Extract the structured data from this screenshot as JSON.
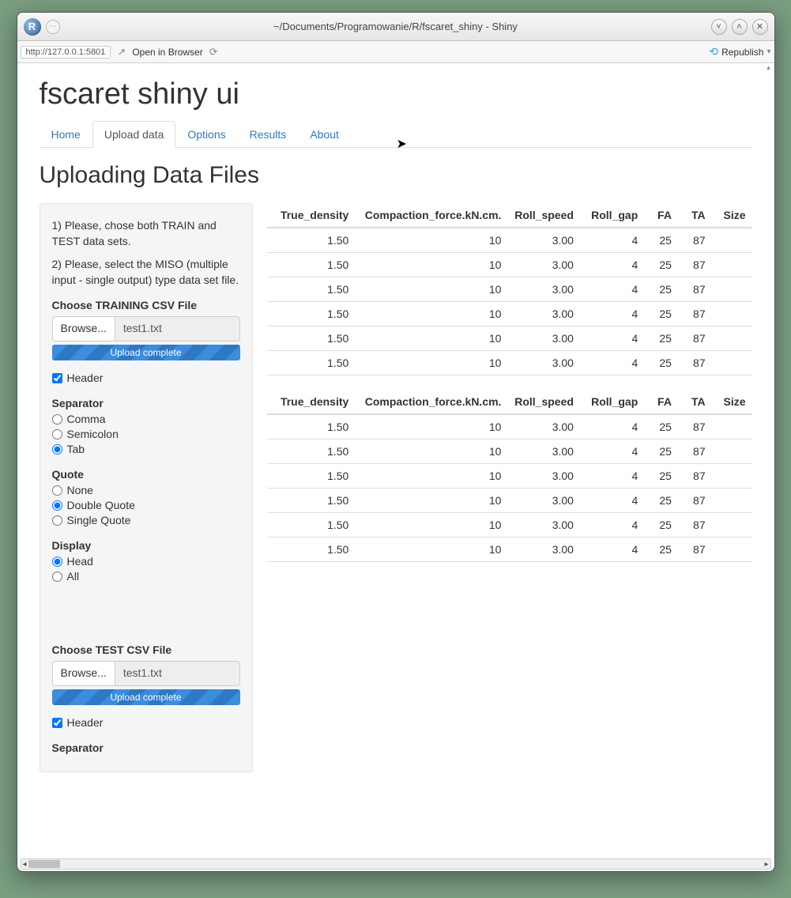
{
  "window": {
    "title": "~/Documents/Programowanie/R/fscaret_shiny - Shiny"
  },
  "toolbar": {
    "url": "http://127.0.0.1:5801",
    "open_in_browser": "Open in Browser",
    "republish": "Republish"
  },
  "app": {
    "title": "fscaret shiny ui"
  },
  "tabs": [
    "Home",
    "Upload data",
    "Options",
    "Results",
    "About"
  ],
  "active_tab_index": 1,
  "section_title": "Uploading Data Files",
  "sidebar": {
    "intro1": "1) Please, chose both TRAIN and TEST data sets.",
    "intro2": "2) Please, select the MISO (multiple input - single output) type data set file.",
    "train": {
      "label": "Choose TRAINING CSV File",
      "browse": "Browse...",
      "filename": "test1.txt",
      "progress": "Upload complete",
      "header_label": "Header",
      "header_checked": true,
      "separator_label": "Separator",
      "separator_options": [
        "Comma",
        "Semicolon",
        "Tab"
      ],
      "separator_selected": 2,
      "quote_label": "Quote",
      "quote_options": [
        "None",
        "Double Quote",
        "Single Quote"
      ],
      "quote_selected": 1,
      "display_label": "Display",
      "display_options": [
        "Head",
        "All"
      ],
      "display_selected": 0
    },
    "test": {
      "label": "Choose TEST CSV File",
      "browse": "Browse...",
      "filename": "test1.txt",
      "progress": "Upload complete",
      "header_label": "Header",
      "header_checked": true,
      "separator_label": "Separator"
    }
  },
  "table": {
    "headers": [
      "True_density",
      "Compaction_force.kN.cm.",
      "Roll_speed",
      "Roll_gap",
      "FA",
      "TA",
      "Size"
    ],
    "col_widths": [
      "110",
      "190",
      "90",
      "80",
      "42",
      "42",
      "50"
    ],
    "rows1": [
      [
        "1.50",
        "10",
        "3.00",
        "4",
        "25",
        "87",
        ""
      ],
      [
        "1.50",
        "10",
        "3.00",
        "4",
        "25",
        "87",
        ""
      ],
      [
        "1.50",
        "10",
        "3.00",
        "4",
        "25",
        "87",
        ""
      ],
      [
        "1.50",
        "10",
        "3.00",
        "4",
        "25",
        "87",
        ""
      ],
      [
        "1.50",
        "10",
        "3.00",
        "4",
        "25",
        "87",
        ""
      ],
      [
        "1.50",
        "10",
        "3.00",
        "4",
        "25",
        "87",
        ""
      ]
    ],
    "rows2": [
      [
        "1.50",
        "10",
        "3.00",
        "4",
        "25",
        "87",
        ""
      ],
      [
        "1.50",
        "10",
        "3.00",
        "4",
        "25",
        "87",
        ""
      ],
      [
        "1.50",
        "10",
        "3.00",
        "4",
        "25",
        "87",
        ""
      ],
      [
        "1.50",
        "10",
        "3.00",
        "4",
        "25",
        "87",
        ""
      ],
      [
        "1.50",
        "10",
        "3.00",
        "4",
        "25",
        "87",
        ""
      ],
      [
        "1.50",
        "10",
        "3.00",
        "4",
        "25",
        "87",
        ""
      ]
    ]
  }
}
